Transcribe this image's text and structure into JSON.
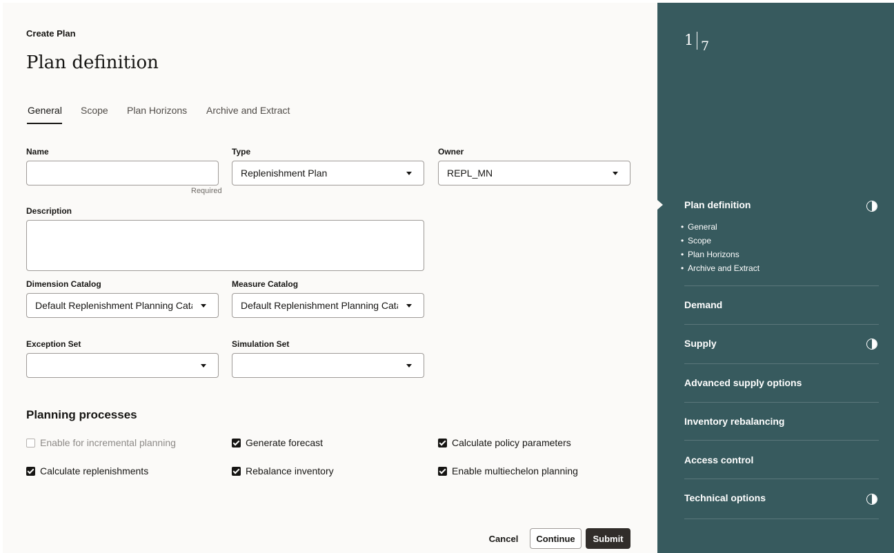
{
  "header": {
    "breadcrumb": "Create Plan",
    "title": "Plan definition"
  },
  "tabs": [
    {
      "label": "General",
      "active": true
    },
    {
      "label": "Scope",
      "active": false
    },
    {
      "label": "Plan Horizons",
      "active": false
    },
    {
      "label": "Archive and Extract",
      "active": false
    }
  ],
  "form": {
    "name": {
      "label": "Name",
      "value": "",
      "helper": "Required"
    },
    "type": {
      "label": "Type",
      "value": "Replenishment Plan"
    },
    "owner": {
      "label": "Owner",
      "value": "REPL_MN"
    },
    "description": {
      "label": "Description",
      "value": ""
    },
    "dimension_catalog": {
      "label": "Dimension Catalog",
      "value": "Default Replenishment Planning Catal"
    },
    "measure_catalog": {
      "label": "Measure Catalog",
      "value": "Default Replenishment Planning Catal"
    },
    "exception_set": {
      "label": "Exception Set",
      "value": ""
    },
    "simulation_set": {
      "label": "Simulation Set",
      "value": ""
    }
  },
  "planning_processes": {
    "title": "Planning processes",
    "items": [
      {
        "label": "Enable for incremental planning",
        "checked": false,
        "disabled": true
      },
      {
        "label": "Generate forecast",
        "checked": true,
        "disabled": false
      },
      {
        "label": "Calculate policy parameters",
        "checked": true,
        "disabled": false
      },
      {
        "label": "Calculate replenishments",
        "checked": true,
        "disabled": false
      },
      {
        "label": "Rebalance inventory",
        "checked": true,
        "disabled": false
      },
      {
        "label": "Enable multiechelon planning",
        "checked": true,
        "disabled": false
      }
    ]
  },
  "actions": {
    "cancel": "Cancel",
    "continue": "Continue",
    "submit": "Submit"
  },
  "steps": {
    "current": "1",
    "total": "7",
    "items": [
      {
        "label": "Plan definition",
        "status_icon": "half-circle-icon",
        "sub_items": [
          "General",
          "Scope",
          "Plan Horizons",
          "Archive and Extract"
        ]
      },
      {
        "label": "Demand",
        "status_icon": ""
      },
      {
        "label": "Supply",
        "status_icon": "half-circle-icon"
      },
      {
        "label": "Advanced supply options",
        "status_icon": ""
      },
      {
        "label": "Inventory rebalancing",
        "status_icon": ""
      },
      {
        "label": "Access control",
        "status_icon": ""
      },
      {
        "label": "Technical options",
        "status_icon": "half-circle-icon"
      }
    ]
  },
  "colors": {
    "side_panel": "#375a5e",
    "main_bg": "#fbfaf8",
    "primary_button": "#312d2a"
  }
}
